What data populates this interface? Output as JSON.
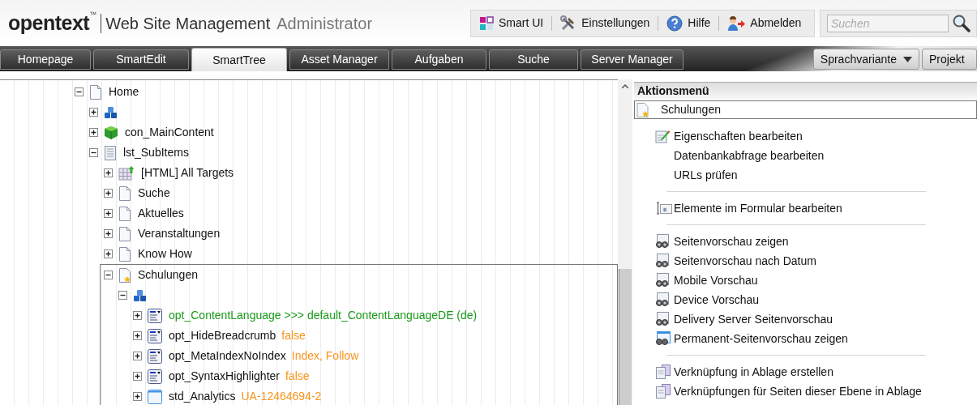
{
  "header": {
    "logo": "opentext",
    "trademark": "™",
    "product": "Web Site Management",
    "role": "Administrator"
  },
  "toolbar": [
    {
      "label": "Smart UI",
      "kind": "smartui"
    },
    {
      "label": "Einstellungen",
      "kind": "tools"
    },
    {
      "label": "Hilfe",
      "kind": "help"
    },
    {
      "label": "Abmelden",
      "kind": "logout"
    }
  ],
  "search": {
    "placeholder": "Suchen"
  },
  "tabs": [
    {
      "label": "Homepage",
      "selected": false
    },
    {
      "label": "SmartEdit",
      "selected": false
    },
    {
      "label": "SmartTree",
      "selected": true
    },
    {
      "label": "Asset Manager",
      "selected": false
    },
    {
      "label": "Aufgaben",
      "selected": false
    },
    {
      "label": "Suche",
      "selected": false
    },
    {
      "label": "Server Manager",
      "selected": false
    }
  ],
  "dropdowns": [
    "Sprachvariante",
    "Projekt"
  ],
  "tree": [
    {
      "label": "Home",
      "kind": "page",
      "expanded": true,
      "selected": false,
      "children": [
        {
          "kind": "blocks",
          "expanded": false,
          "selected": false
        },
        {
          "label": "con_MainContent",
          "kind": "cube",
          "expanded": false,
          "selected": false
        },
        {
          "label": "lst_SubItems",
          "kind": "list",
          "expanded": true,
          "selected": false,
          "children": [
            {
              "label": "[HTML] All Targets",
              "kind": "grid",
              "expanded": false,
              "selected": false
            },
            {
              "label": "Suche",
              "kind": "page",
              "expanded": false,
              "selected": false
            },
            {
              "label": "Aktuelles",
              "kind": "page",
              "expanded": false,
              "selected": false
            },
            {
              "label": "Veranstaltungen",
              "kind": "page",
              "expanded": false,
              "selected": false
            },
            {
              "label": "Know How",
              "kind": "page",
              "expanded": false,
              "selected": false
            },
            {
              "label": "Schulungen",
              "kind": "page-star",
              "expanded": true,
              "selected": true,
              "children": [
                {
                  "kind": "blocks",
                  "expanded": true,
                  "selected": false,
                  "children": [
                    {
                      "label": "opt_ContentLanguage >>> default_ContentLanguageDE (de)",
                      "kind": "option",
                      "linked": true,
                      "expanded": false,
                      "selected": false
                    },
                    {
                      "label": "opt_HideBreadcrumb",
                      "value": "false",
                      "kind": "option",
                      "expanded": false,
                      "selected": false
                    },
                    {
                      "label": "opt_MetaIndexNoIndex",
                      "value": "Index, Follow",
                      "kind": "option",
                      "expanded": false,
                      "selected": false
                    },
                    {
                      "label": "opt_SyntaxHighlighter",
                      "value": "false",
                      "kind": "option",
                      "expanded": false,
                      "selected": false
                    },
                    {
                      "label": "std_Analytics",
                      "value": "UA-12464694-2",
                      "kind": "standard",
                      "expanded": false,
                      "selected": false
                    }
                  ]
                }
              ]
            }
          ]
        }
      ]
    }
  ],
  "action_menu": {
    "title": "Aktionsmenü",
    "context": "Schulungen",
    "sections": [
      [
        {
          "label": "Eigenschaften bearbeiten",
          "kind": "edit"
        },
        {
          "label": "Datenbankabfrage bearbeiten",
          "kind": "plain"
        },
        {
          "label": "URLs prüfen",
          "kind": "plain"
        }
      ],
      [
        {
          "label": "Elemente im Formular bearbeiten",
          "kind": "form"
        }
      ],
      [
        {
          "label": "Seitenvorschau zeigen",
          "kind": "preview"
        },
        {
          "label": "Seitenvorschau nach Datum",
          "kind": "preview"
        },
        {
          "label": "Mobile Vorschau",
          "kind": "preview"
        },
        {
          "label": "Device Vorschau",
          "kind": "preview"
        },
        {
          "label": "Delivery Server Seitenvorschau",
          "kind": "preview"
        },
        {
          "label": "Permanent-Seitenvorschau zeigen",
          "kind": "permanent"
        }
      ],
      [
        {
          "label": "Verknüpfung in Ablage erstellen",
          "kind": "clipboard"
        },
        {
          "label": "Verknüpfungen für Seiten dieser Ebene in Ablage",
          "kind": "clipboard"
        }
      ]
    ]
  }
}
